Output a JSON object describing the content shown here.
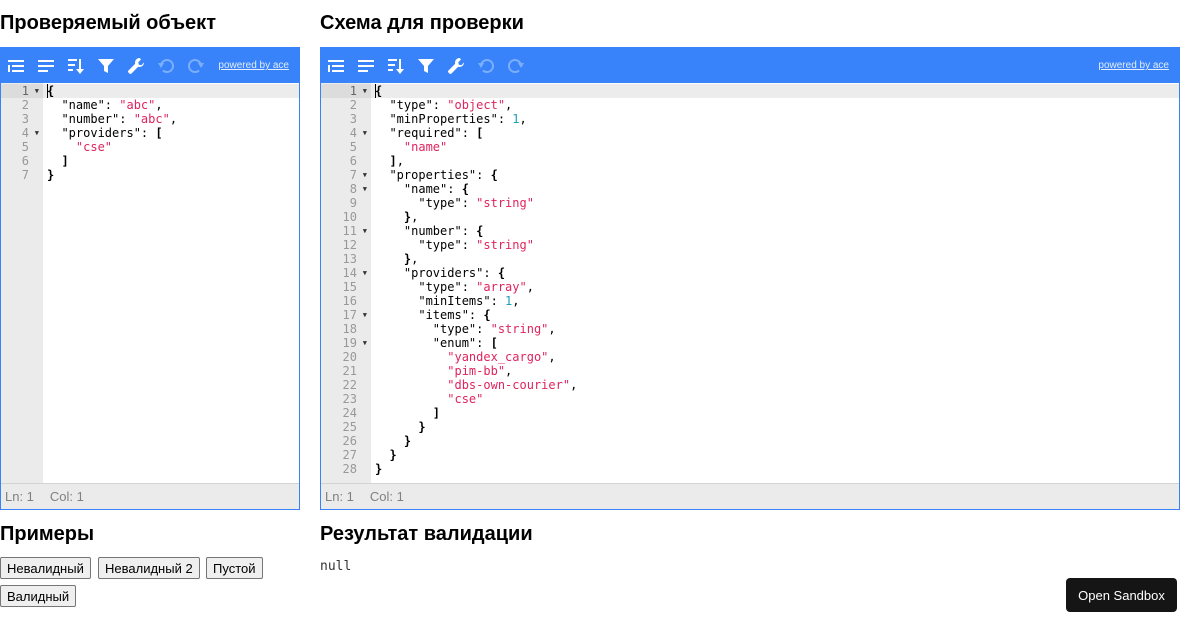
{
  "left_panel": {
    "title": "Проверяемый объект",
    "powered_by": "powered by ace",
    "status": {
      "ln": "Ln: 1",
      "col": "Col: 1"
    },
    "lines": [
      {
        "n": "1",
        "fold": true,
        "tokens": [
          [
            "p",
            "{"
          ]
        ]
      },
      {
        "n": "2",
        "fold": false,
        "tokens": [
          [
            "k",
            "  \"name\""
          ],
          [
            "x",
            ": "
          ],
          [
            "s",
            "\"abc\""
          ],
          [
            "x",
            ","
          ]
        ]
      },
      {
        "n": "3",
        "fold": false,
        "tokens": [
          [
            "k",
            "  \"number\""
          ],
          [
            "x",
            ": "
          ],
          [
            "s",
            "\"abc\""
          ],
          [
            "x",
            ","
          ]
        ]
      },
      {
        "n": "4",
        "fold": true,
        "tokens": [
          [
            "k",
            "  \"providers\""
          ],
          [
            "x",
            ": "
          ],
          [
            "p",
            "["
          ]
        ]
      },
      {
        "n": "5",
        "fold": false,
        "tokens": [
          [
            "s",
            "    \"cse\""
          ]
        ]
      },
      {
        "n": "6",
        "fold": false,
        "tokens": [
          [
            "p",
            "  ]"
          ]
        ]
      },
      {
        "n": "7",
        "fold": false,
        "tokens": [
          [
            "p",
            "}"
          ]
        ]
      }
    ]
  },
  "right_panel": {
    "title": "Схема для проверки",
    "powered_by": "powered by ace",
    "status": {
      "ln": "Ln: 1",
      "col": "Col: 1"
    },
    "lines": [
      {
        "n": "1",
        "fold": true,
        "tokens": [
          [
            "p",
            "{"
          ]
        ]
      },
      {
        "n": "2",
        "fold": false,
        "tokens": [
          [
            "k",
            "  \"type\""
          ],
          [
            "x",
            ": "
          ],
          [
            "s",
            "\"object\""
          ],
          [
            "x",
            ","
          ]
        ]
      },
      {
        "n": "3",
        "fold": false,
        "tokens": [
          [
            "k",
            "  \"minProperties\""
          ],
          [
            "x",
            ": "
          ],
          [
            "n",
            "1"
          ],
          [
            "x",
            ","
          ]
        ]
      },
      {
        "n": "4",
        "fold": true,
        "tokens": [
          [
            "k",
            "  \"required\""
          ],
          [
            "x",
            ": "
          ],
          [
            "p",
            "["
          ]
        ]
      },
      {
        "n": "5",
        "fold": false,
        "tokens": [
          [
            "s",
            "    \"name\""
          ]
        ]
      },
      {
        "n": "6",
        "fold": false,
        "tokens": [
          [
            "p",
            "  ]"
          ],
          [
            "x",
            ","
          ]
        ]
      },
      {
        "n": "7",
        "fold": true,
        "tokens": [
          [
            "k",
            "  \"properties\""
          ],
          [
            "x",
            ": "
          ],
          [
            "p",
            "{"
          ]
        ]
      },
      {
        "n": "8",
        "fold": true,
        "tokens": [
          [
            "k",
            "    \"name\""
          ],
          [
            "x",
            ": "
          ],
          [
            "p",
            "{"
          ]
        ]
      },
      {
        "n": "9",
        "fold": false,
        "tokens": [
          [
            "k",
            "      \"type\""
          ],
          [
            "x",
            ": "
          ],
          [
            "s",
            "\"string\""
          ]
        ]
      },
      {
        "n": "10",
        "fold": false,
        "tokens": [
          [
            "p",
            "    }"
          ],
          [
            "x",
            ","
          ]
        ]
      },
      {
        "n": "11",
        "fold": true,
        "tokens": [
          [
            "k",
            "    \"number\""
          ],
          [
            "x",
            ": "
          ],
          [
            "p",
            "{"
          ]
        ]
      },
      {
        "n": "12",
        "fold": false,
        "tokens": [
          [
            "k",
            "      \"type\""
          ],
          [
            "x",
            ": "
          ],
          [
            "s",
            "\"string\""
          ]
        ]
      },
      {
        "n": "13",
        "fold": false,
        "tokens": [
          [
            "p",
            "    }"
          ],
          [
            "x",
            ","
          ]
        ]
      },
      {
        "n": "14",
        "fold": true,
        "tokens": [
          [
            "k",
            "    \"providers\""
          ],
          [
            "x",
            ": "
          ],
          [
            "p",
            "{"
          ]
        ]
      },
      {
        "n": "15",
        "fold": false,
        "tokens": [
          [
            "k",
            "      \"type\""
          ],
          [
            "x",
            ": "
          ],
          [
            "s",
            "\"array\""
          ],
          [
            "x",
            ","
          ]
        ]
      },
      {
        "n": "16",
        "fold": false,
        "tokens": [
          [
            "k",
            "      \"minItems\""
          ],
          [
            "x",
            ": "
          ],
          [
            "n",
            "1"
          ],
          [
            "x",
            ","
          ]
        ]
      },
      {
        "n": "17",
        "fold": true,
        "tokens": [
          [
            "k",
            "      \"items\""
          ],
          [
            "x",
            ": "
          ],
          [
            "p",
            "{"
          ]
        ]
      },
      {
        "n": "18",
        "fold": false,
        "tokens": [
          [
            "k",
            "        \"type\""
          ],
          [
            "x",
            ": "
          ],
          [
            "s",
            "\"string\""
          ],
          [
            "x",
            ","
          ]
        ]
      },
      {
        "n": "19",
        "fold": true,
        "tokens": [
          [
            "k",
            "        \"enum\""
          ],
          [
            "x",
            ": "
          ],
          [
            "p",
            "["
          ]
        ]
      },
      {
        "n": "20",
        "fold": false,
        "tokens": [
          [
            "s",
            "          \"yandex_cargo\""
          ],
          [
            "x",
            ","
          ]
        ]
      },
      {
        "n": "21",
        "fold": false,
        "tokens": [
          [
            "s",
            "          \"pim-bb\""
          ],
          [
            "x",
            ","
          ]
        ]
      },
      {
        "n": "22",
        "fold": false,
        "tokens": [
          [
            "s",
            "          \"dbs-own-courier\""
          ],
          [
            "x",
            ","
          ]
        ]
      },
      {
        "n": "23",
        "fold": false,
        "tokens": [
          [
            "s",
            "          \"cse\""
          ]
        ]
      },
      {
        "n": "24",
        "fold": false,
        "tokens": [
          [
            "p",
            "        ]"
          ]
        ]
      },
      {
        "n": "25",
        "fold": false,
        "tokens": [
          [
            "p",
            "      }"
          ]
        ]
      },
      {
        "n": "26",
        "fold": false,
        "tokens": [
          [
            "p",
            "    }"
          ]
        ]
      },
      {
        "n": "27",
        "fold": false,
        "tokens": [
          [
            "p",
            "  }"
          ]
        ]
      },
      {
        "n": "28",
        "fold": false,
        "tokens": [
          [
            "p",
            "}"
          ]
        ]
      }
    ]
  },
  "examples": {
    "title": "Примеры",
    "buttons": [
      "Невалидный",
      "Невалидный 2",
      "Пустой",
      "Валидный"
    ]
  },
  "result": {
    "title": "Результат валидации",
    "value": "null"
  },
  "sandbox_button": "Open Sandbox",
  "colors": {
    "accent": "#3883fa",
    "string": "#e0245e",
    "number": "#1ca0b3",
    "gutter": "#ebebeb"
  },
  "toolbar_icons": [
    "format-icon",
    "compact-icon",
    "sort-icon",
    "filter-icon",
    "repair-icon",
    "undo-icon",
    "redo-icon"
  ]
}
